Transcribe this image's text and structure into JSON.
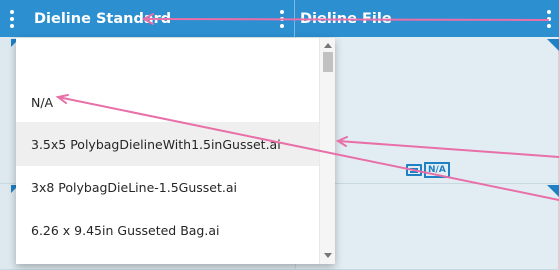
{
  "header": {
    "col1_title": "Dieline Standard",
    "col2_title": "Dieline File"
  },
  "cells": {
    "badge_text": "N/A"
  },
  "dropdown": {
    "options": [
      {
        "label": ""
      },
      {
        "label": "N/A"
      },
      {
        "label": "3.5x5 PolybagDielineWith1.5inGusset.ai"
      },
      {
        "label": "3x8 PolybagDieLine-1.5Gusset.ai"
      },
      {
        "label": "6.26 x 9.45in Gusseted Bag.ai"
      }
    ],
    "highlighted_index": 2
  },
  "colors": {
    "header_bg": "#2c8fcf",
    "accent": "#1f80c4",
    "annotation_arrow": "#e86fa8"
  },
  "icons": [
    "kebab-menu-icon",
    "scroll-up-icon",
    "scroll-down-icon",
    "dieline-file-icon"
  ]
}
